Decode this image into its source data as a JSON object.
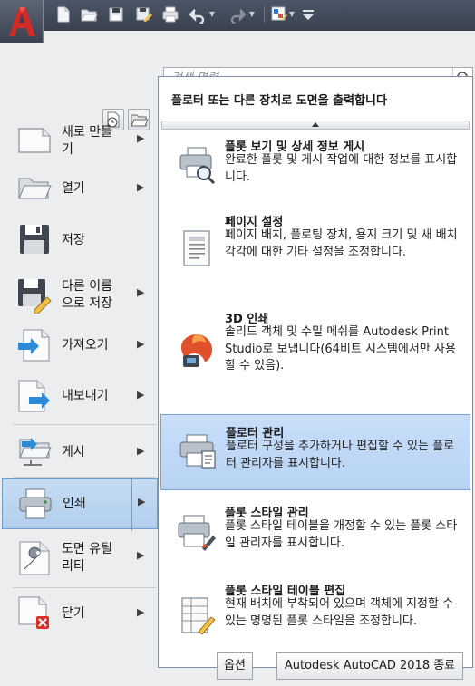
{
  "search": {
    "placeholder": "검색 명령"
  },
  "menu": [
    {
      "label": "새로 만들\n기",
      "icon": "new-document-icon",
      "has_submenu": true
    },
    {
      "label": "열기",
      "icon": "open-folder-icon",
      "has_submenu": true
    },
    {
      "label": "저장",
      "icon": "save-icon",
      "has_submenu": false
    },
    {
      "label": "다른 이름\n으로 저장",
      "icon": "save-as-icon",
      "has_submenu": true
    },
    {
      "label": "가져오기",
      "icon": "import-icon",
      "has_submenu": true
    },
    {
      "label": "내보내기",
      "icon": "export-icon",
      "has_submenu": true
    },
    {
      "label": "게시",
      "icon": "publish-icon",
      "has_submenu": true
    },
    {
      "label": "인쇄",
      "icon": "printer-icon",
      "has_submenu": true,
      "active": true
    },
    {
      "label": "도면 유틸\n리티",
      "icon": "drawing-utilities-icon",
      "has_submenu": true
    },
    {
      "label": "닫기",
      "icon": "close-document-icon",
      "has_submenu": true
    }
  ],
  "flyout": {
    "title": "플로터 또는 다른 장치로 도면을 출력합니다",
    "items": [
      {
        "title": "플롯 보기 및 상세 정보 게시",
        "desc": "완료한 플롯 및 게시 작업에 대한 정보를 표시합니다.",
        "icon": "plot-details-icon"
      },
      {
        "title": "페이지 설정",
        "desc": "페이지 배치, 플로팅 장치, 용지 크기 및 새 배치 각각에 대한 기타 설정을 조정합니다.",
        "icon": "page-setup-icon"
      },
      {
        "title": "3D 인쇄",
        "desc": "솔리드 객체 및 수밀 메쉬를 Autodesk Print Studio로 보냅니다(64비트 시스템에서만 사용할 수 있음).",
        "icon": "3d-print-icon"
      },
      {
        "title": "플로터 관리",
        "desc": "플로터 구성을 추가하거나 편집할 수 있는 플로터 관리자를 표시합니다.",
        "icon": "plotter-manager-icon",
        "active": true
      },
      {
        "title": "플롯 스타일 관리",
        "desc": "플롯 스타일 테이블을 개정할 수 있는 플롯 스타일 관리자를 표시합니다.",
        "icon": "plot-style-manager-icon"
      },
      {
        "title": "플롯 스타일 테이블 편집",
        "desc": "현재 배치에 부착되어 있으며 객체에 지정할 수 있는 명명된 플롯 스타일을 조정합니다.",
        "icon": "plot-style-table-icon"
      }
    ]
  },
  "buttons": {
    "options": "옵션",
    "exit": "Autodesk AutoCAD 2018 종료"
  },
  "quick_access": [
    "new-icon",
    "open-icon",
    "save-icon",
    "save-as-icon",
    "plot-icon",
    "undo-icon",
    "redo-icon",
    "workspace-icon"
  ]
}
